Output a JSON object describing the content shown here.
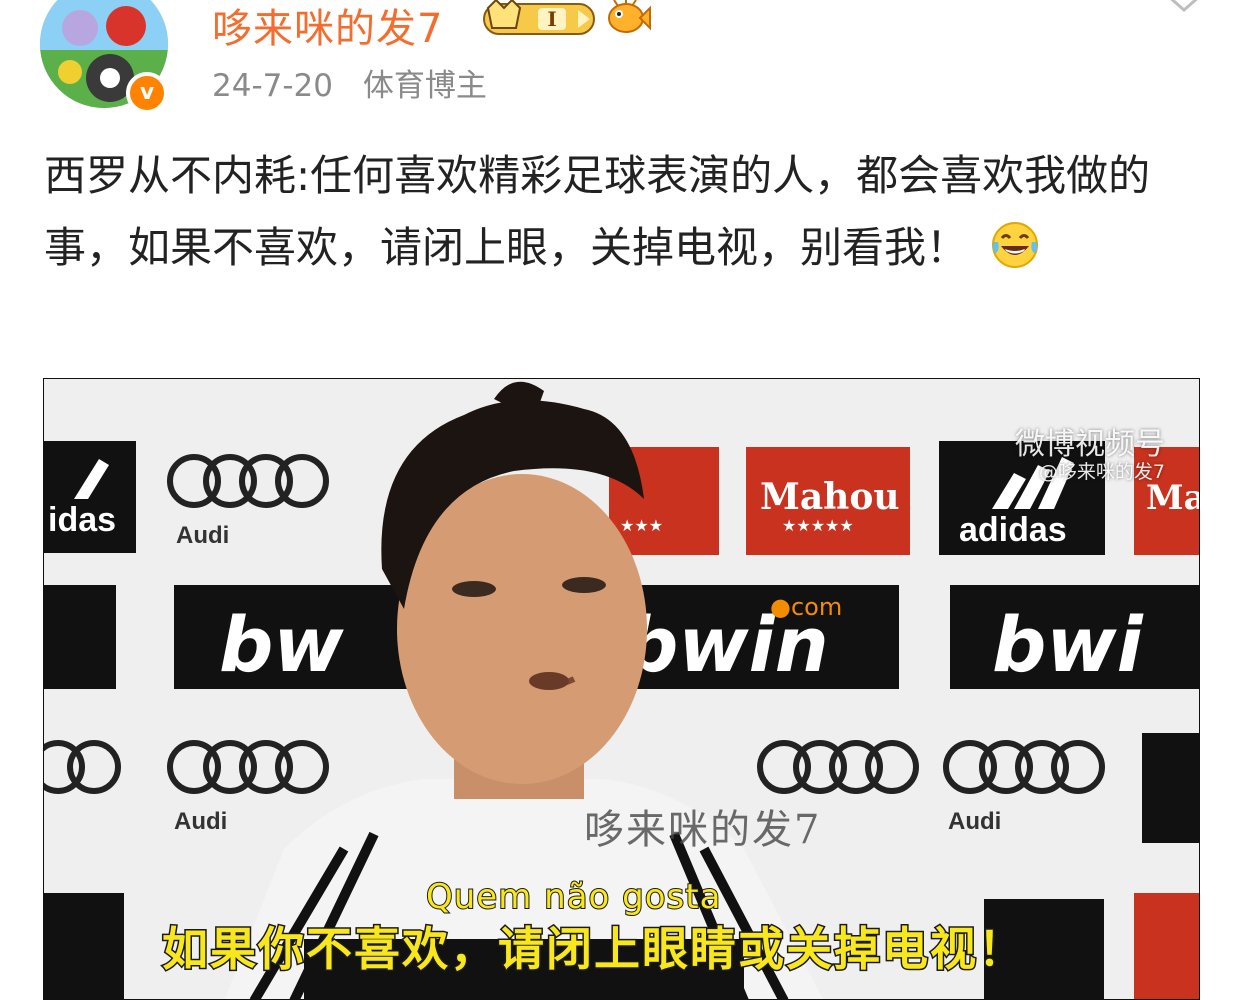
{
  "author": {
    "name": "哆来咪的发7",
    "verified_mark": "v",
    "level_badge": "I",
    "icons": [
      "avatar-cartoon",
      "verified-badge",
      "crown-level-badge",
      "fish-badge",
      "chevron-down-icon"
    ]
  },
  "post": {
    "date": "24-7-20",
    "author_tag": "体育博主",
    "text": "西罗从不内耗:任何喜欢精彩足球表演的人，都会喜欢我做的事，如果不喜欢，请闭上眼，关掉电视，别看我！",
    "emoji": "laughing-tears-emoji"
  },
  "media": {
    "watermark_platform": "微博视频号",
    "watermark_handle": "@哆来咪的发7",
    "center_watermark": "哆来咪的发7",
    "subtitle_original": "Quem não gosta",
    "subtitle_translation": "如果你不喜欢，请闭上眼睛或关掉电视！",
    "backdrop_logos": [
      "Audi",
      "adidas",
      "bwin",
      "Mahou"
    ],
    "colors": {
      "adidas_bg": "#111111",
      "mahou_bg": "#c8321e",
      "bwin_bg": "#111111",
      "backdrop": "#efefef"
    }
  },
  "colors": {
    "username": "#f26d2e",
    "meta": "#8a8a8a",
    "text": "#222222",
    "verified": "#ff8200",
    "subtitle": "#f8e71c"
  }
}
